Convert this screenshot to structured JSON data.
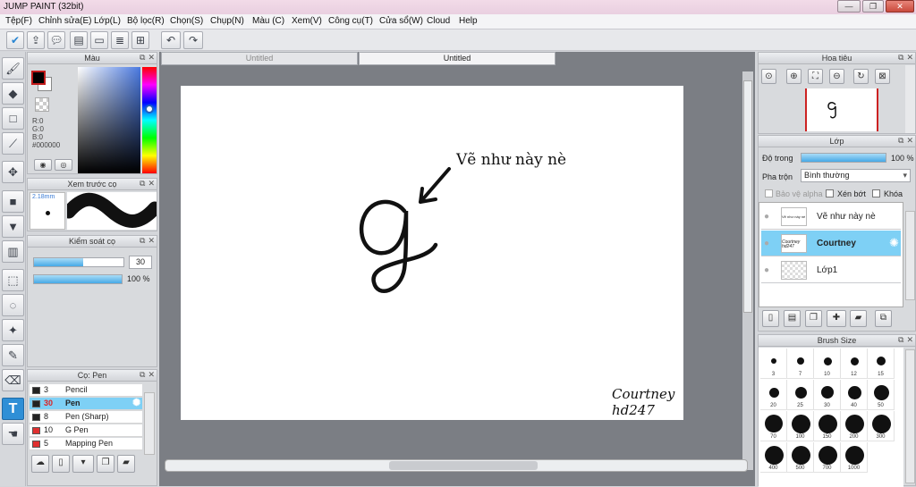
{
  "window": {
    "title": "JUMP PAINT (32bit)",
    "minimize": "—",
    "maximize": "❐",
    "close": "✕"
  },
  "menu": [
    "Tệp(F)",
    "Chỉnh sửa(E)",
    "Lớp(L)",
    "Bộ lọc(R)",
    "Chọn(S)",
    "Chụp(N)",
    "Màu (C)",
    "Xem(V)",
    "Công cụ(T)",
    "Cửa sổ(W)",
    "Cloud",
    "Help"
  ],
  "toolbar_icons": [
    "check-icon",
    "share-icon",
    "comment-icon",
    "comment-box-icon",
    "page-icon",
    "page-lines-icon",
    "grid-icon",
    "undo-icon",
    "redo-icon"
  ],
  "tools": [
    "brush-icon",
    "eraser-icon",
    "rect-icon",
    "line-icon",
    "move-icon",
    "fill-rect-icon",
    "bucket-icon",
    "gradient-icon",
    "select-rect-icon",
    "lasso-icon",
    "magic-wand-icon",
    "select-pen-icon",
    "select-eraser-icon",
    "text-icon",
    "hand-icon"
  ],
  "color_panel": {
    "title": "Màu",
    "r": "R:0",
    "g": "G:0",
    "b": "B:0",
    "hex": "#000000",
    "fg_color": "#000000",
    "bg_color": "#ffffff"
  },
  "brush_preview": {
    "title": "Xem trước cọ",
    "size": "2.18mm"
  },
  "brush_control": {
    "title": "Kiểm soát cọ",
    "size_value": "30",
    "opacity_value": "100 %",
    "size_fraction": 0.55,
    "opacity_fraction": 1.0
  },
  "brush_list": {
    "title": "Cọ: Pen",
    "items": [
      {
        "size": "3",
        "name": "Pencil",
        "color": "#222222"
      },
      {
        "size": "30",
        "name": "Pen",
        "color": "#222222"
      },
      {
        "size": "8",
        "name": "Pen (Sharp)",
        "color": "#222222"
      },
      {
        "size": "10",
        "name": "G Pen",
        "color": "#e03030"
      },
      {
        "size": "5",
        "name": "Mapping Pen",
        "color": "#e03030"
      }
    ]
  },
  "tabs": [
    "Untitled",
    "Untitled"
  ],
  "canvas": {
    "annotation": "Vẽ như này nè",
    "glyph": "g",
    "signature_line1": "Courtney",
    "signature_line2": "hd247"
  },
  "navigator": {
    "title": "Hoa tiêu"
  },
  "layers": {
    "title": "Lớp",
    "opacity_label": "Độ trong",
    "opacity_value": "100 %",
    "opacity_fraction": 1.0,
    "blend_label": "Pha trộn",
    "blend_value": "Bình thường",
    "protect_alpha": "Bảo vệ alpha",
    "clipping": "Xén bớt",
    "lock": "Khóa",
    "items": [
      {
        "name": "Vẽ như này nè",
        "thumb": "Vẽ như này nè"
      },
      {
        "name": "Courtney",
        "thumb": "Courtney hd247"
      },
      {
        "name": "Lớp1",
        "thumb": ""
      }
    ]
  },
  "brush_size": {
    "title": "Brush Size",
    "sizes": [
      "3",
      "7",
      "10",
      "12",
      "15",
      "20",
      "25",
      "30",
      "40",
      "50",
      "70",
      "100",
      "150",
      "200",
      "300",
      "400",
      "500",
      "700",
      "1000"
    ]
  }
}
